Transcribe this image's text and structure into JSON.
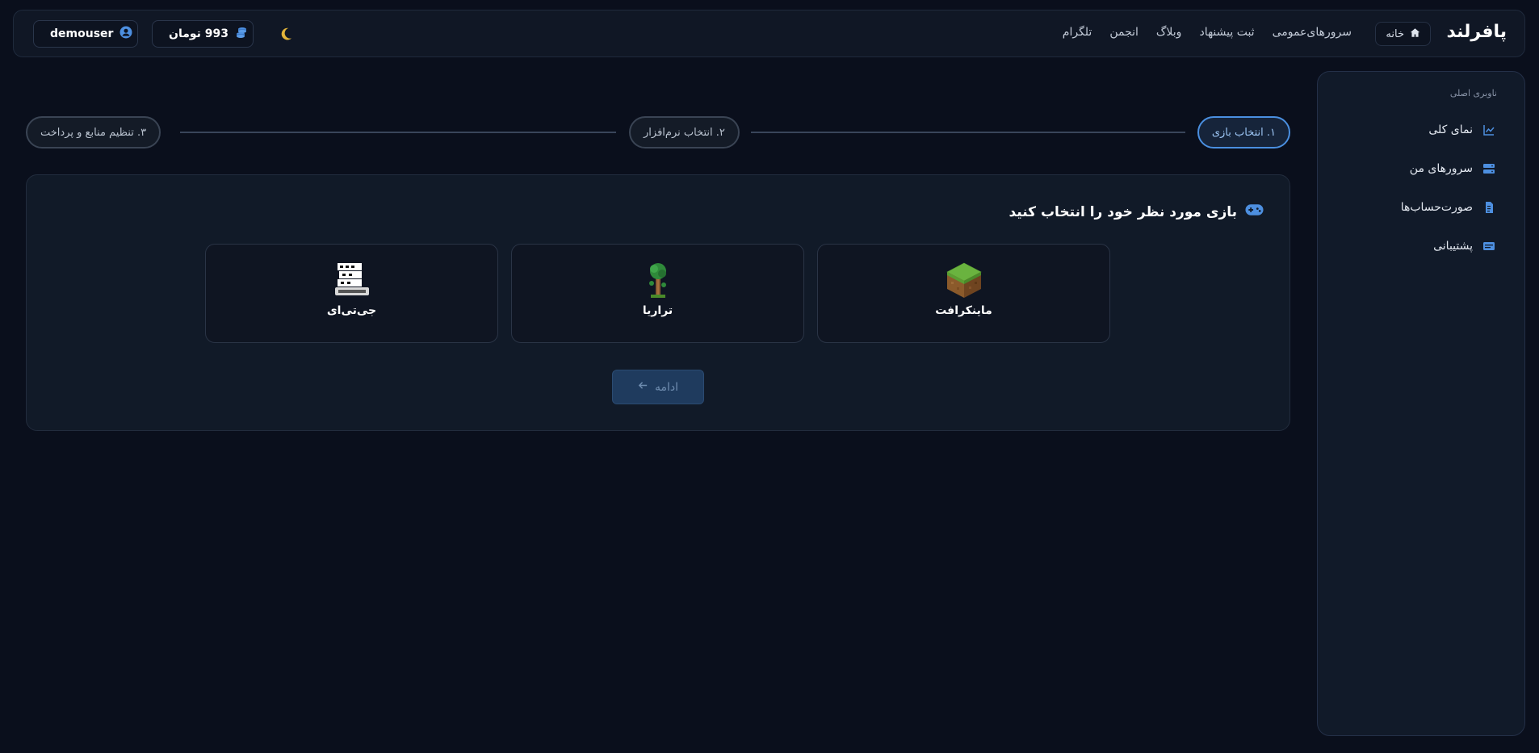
{
  "header": {
    "brand": "پافرلند",
    "home_label": "خانه",
    "nav": [
      "سرورهای‌عمومی",
      "ثبت پیشنهاد",
      "وبلاگ",
      "انجمن",
      "تلگرام"
    ],
    "wallet_label": "993 تومان",
    "username": "demouser"
  },
  "sidebar": {
    "heading": "ناوبری اصلی",
    "items": [
      {
        "label": "نمای کلی",
        "icon": "chart-line-icon"
      },
      {
        "label": "سرورهای من",
        "icon": "server-icon"
      },
      {
        "label": "صورت‌حساب‌ها",
        "icon": "invoice-icon"
      },
      {
        "label": "پشتیبانی",
        "icon": "support-icon"
      }
    ]
  },
  "stepper": {
    "steps": [
      "۱. انتخاب بازی",
      "۲. انتخاب نرم‌افزار",
      "۳. تنظیم منابع و پرداخت"
    ],
    "active_index": 0
  },
  "main": {
    "title": "بازی مورد نظر خود را انتخاب کنید",
    "games": [
      {
        "name": "ماینکرافت",
        "icon": "minecraft-icon"
      },
      {
        "name": "تراریا",
        "icon": "terraria-icon"
      },
      {
        "name": "جی‌تی‌ای",
        "icon": "gta-icon"
      }
    ],
    "continue_label": "ادامه"
  },
  "colors": {
    "background": "#0a0f1c",
    "accent": "#4a8fe0",
    "moon": "#e2b43a"
  }
}
